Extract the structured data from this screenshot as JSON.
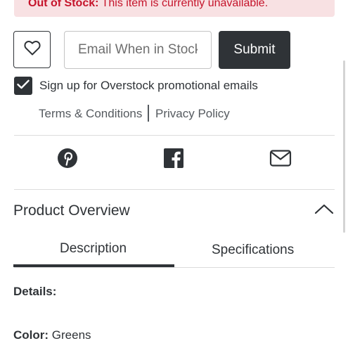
{
  "alert": {
    "strong_text": "Out of Stock:",
    "text": "This item is currently unavailable."
  },
  "notify": {
    "placeholder": "Email When in Stock",
    "submit_label": "Submit"
  },
  "optin": {
    "checked": true,
    "label": "Sign up for Overstock promotional emails"
  },
  "links": {
    "terms": "Terms & Conditions",
    "privacy": "Privacy Policy"
  },
  "share": {
    "icons": [
      "pinterest-icon",
      "facebook-icon",
      "email-icon"
    ]
  },
  "overview": {
    "title": "Product Overview",
    "expanded": true,
    "tabs": [
      {
        "label": "Description",
        "active": true
      },
      {
        "label": "Specifications",
        "active": false
      }
    ],
    "details_label": "Details:",
    "color_key": "Color:",
    "color_value": "Greens"
  },
  "colors": {
    "text": "#2f3337",
    "alert_bg": "#f8e1e3",
    "alert_text": "#c5142b",
    "button": "#2f3337"
  }
}
